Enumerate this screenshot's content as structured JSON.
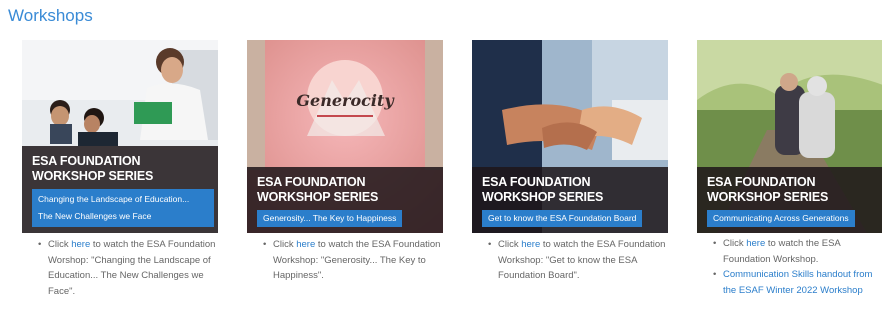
{
  "section_title": "Workshops",
  "cards": [
    {
      "series_title": "ESA FOUNDATION WORKSHOP SERIES",
      "subtitle_lines": [
        "Changing the Landscape of Education...",
        "The New Challenges we Face"
      ],
      "click": "Click",
      "here": "here",
      "rest": "to watch the ESA Foundation Worshop: \"Changing the Landscape of Education... The New Challenges we Face\"."
    },
    {
      "series_title": "ESA FOUNDATION WORKSHOP SERIES",
      "subtitle_lines": [
        "Generosity... The Key to Happiness"
      ],
      "generocity_word": "Generocity",
      "click": "Click",
      "here": "here",
      "rest": "to watch the ESA Foundation Workshop: \"Generosity... The Key to Happiness\"."
    },
    {
      "series_title": "ESA FOUNDATION WORKSHOP SERIES",
      "subtitle_lines": [
        "Get to know the ESA Foundation Board"
      ],
      "click": "Click",
      "here": "here",
      "rest": "to watch the ESA Foundation Workshop: \"Get to know the ESA Foundation Board\"."
    },
    {
      "series_title": "ESA FOUNDATION WORKSHOP SERIES",
      "subtitle_lines": [
        "Communicating Across Generations"
      ],
      "click": "Click",
      "here": "here",
      "rest": "to watch the ESA Foundation Workshop.",
      "extra_link": "Communication Skills handout from the ESAF Winter 2022 Workshop"
    }
  ]
}
